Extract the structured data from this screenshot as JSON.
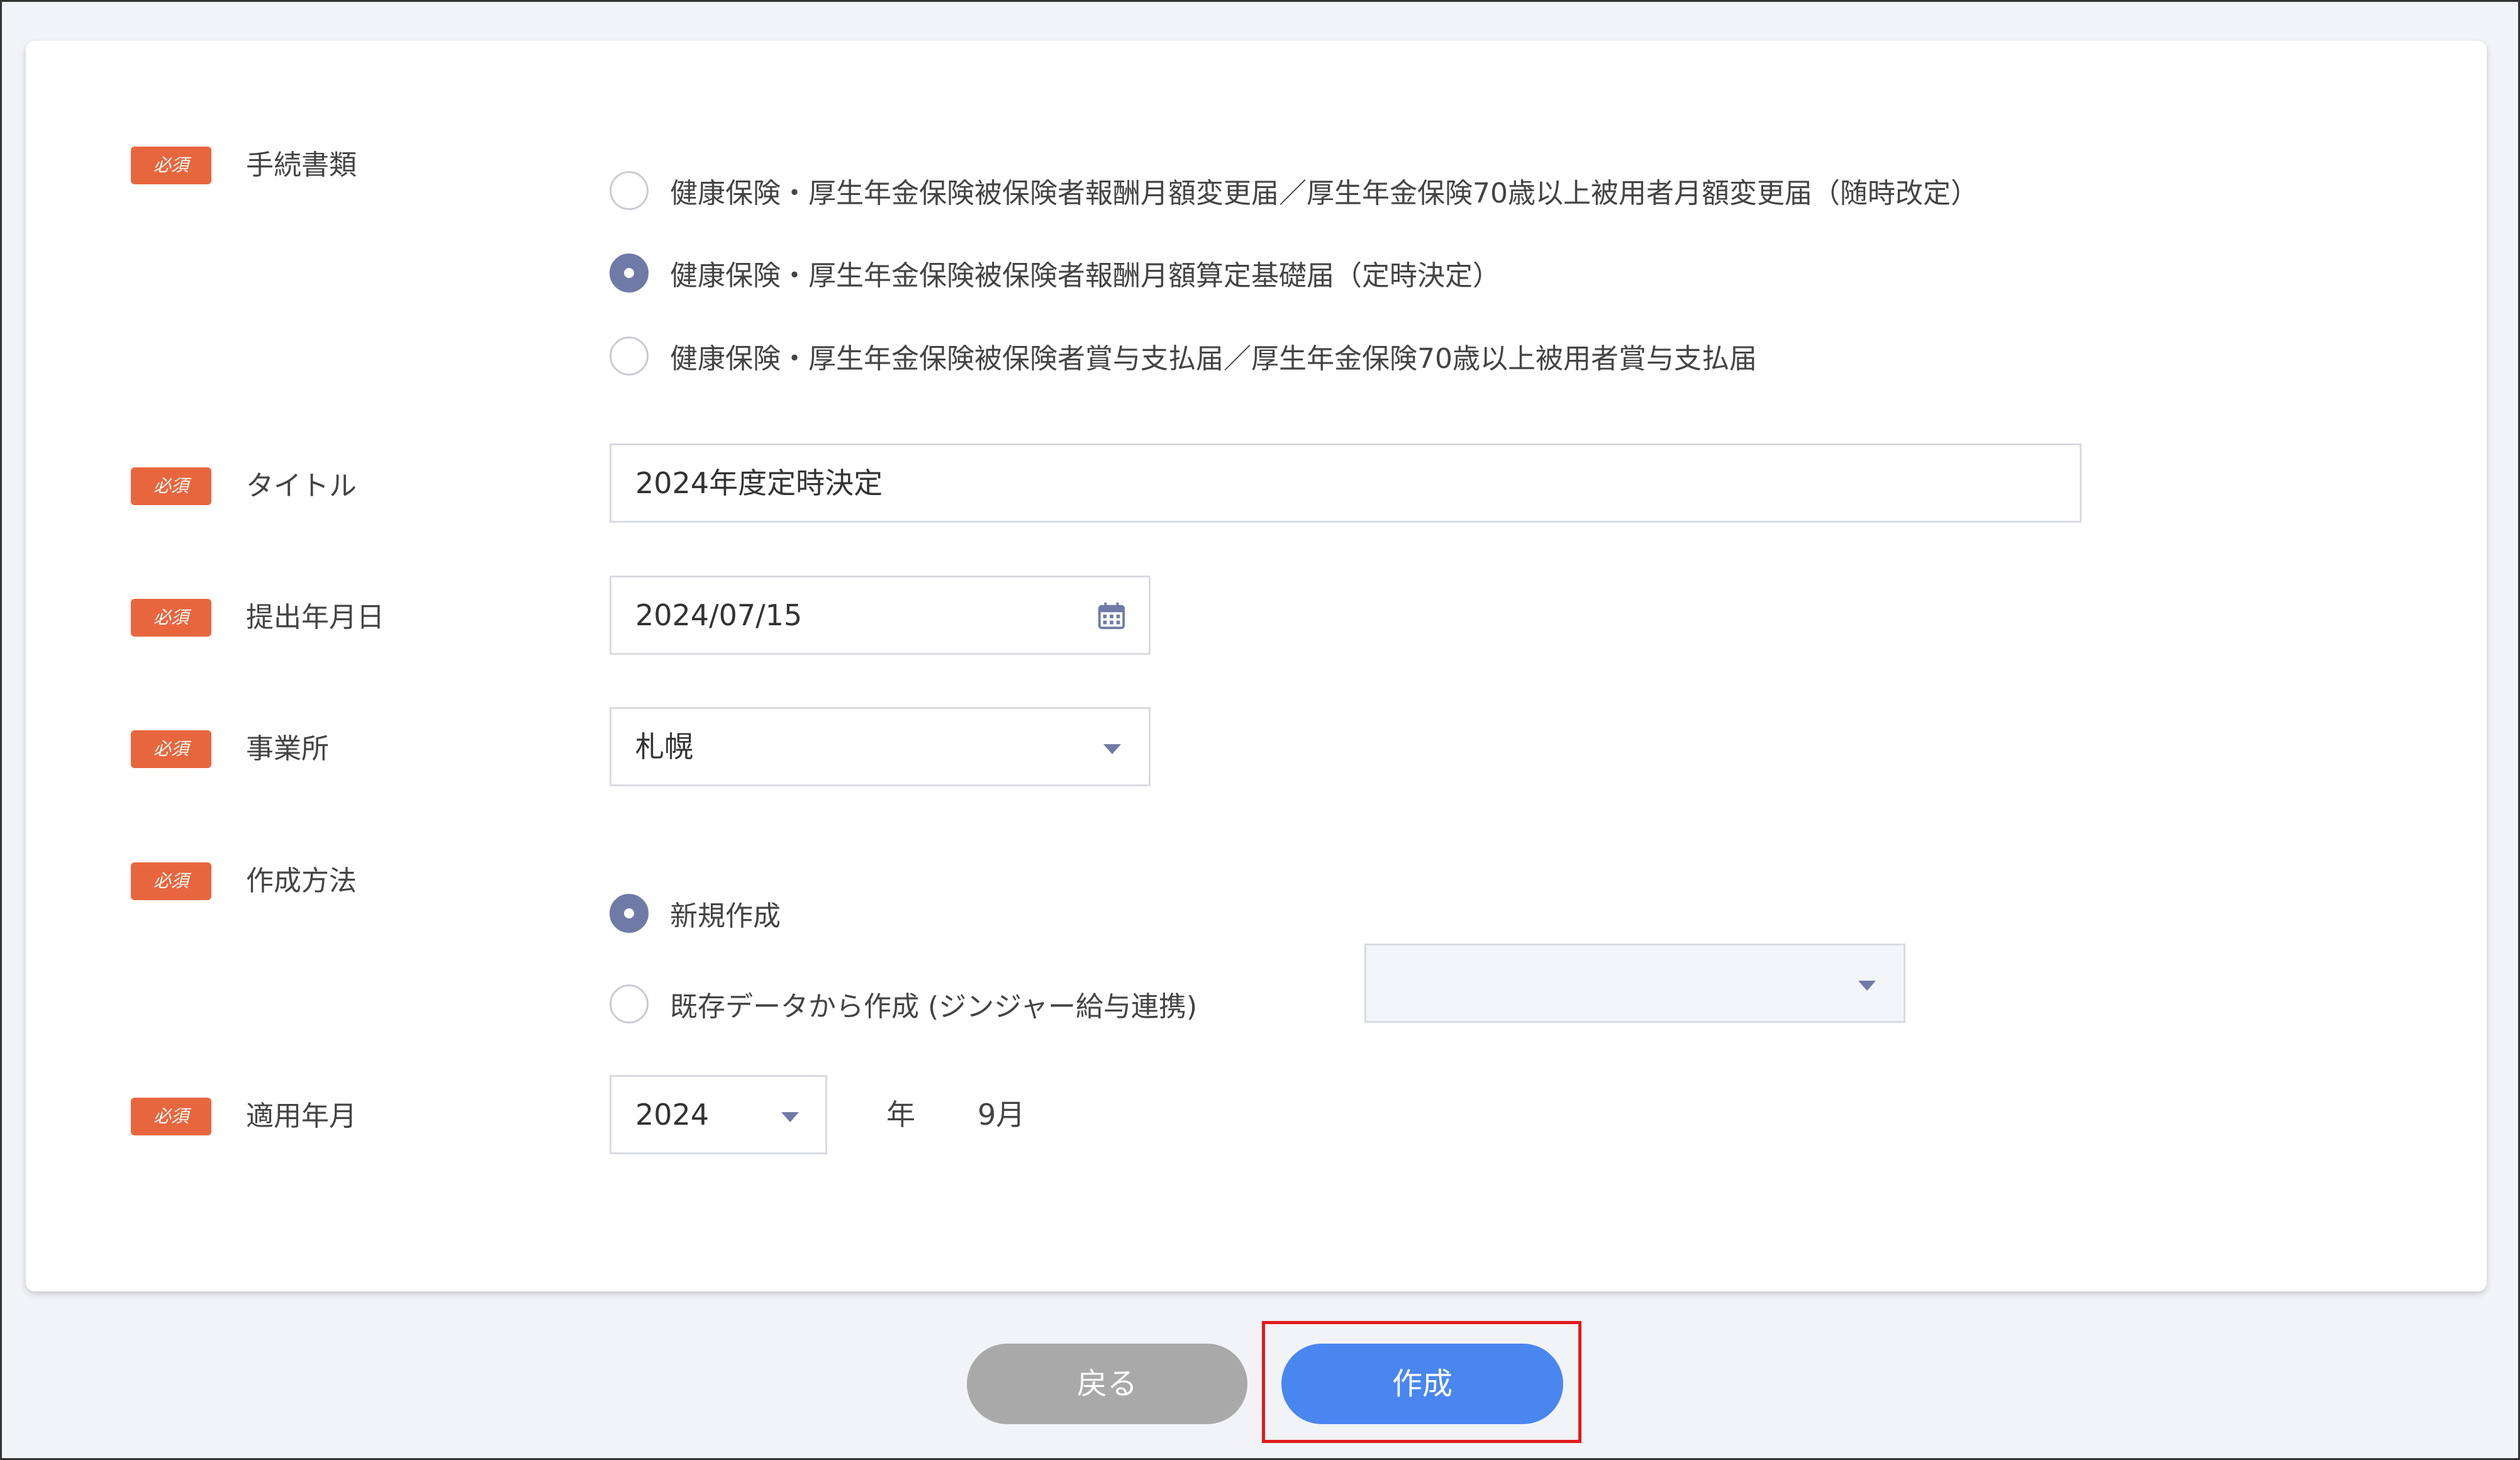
{
  "form": {
    "required_badge": "必須",
    "procedure": {
      "label": "手続書類",
      "options": [
        {
          "text": "健康保険・厚生年金保険被保険者報酬月額変更届／厚生年金保険70歳以上被用者月額変更届（随時改定）",
          "selected": false
        },
        {
          "text": "健康保険・厚生年金保険被保険者報酬月額算定基礎届（定時決定）",
          "selected": true
        },
        {
          "text": "健康保険・厚生年金保険被保険者賞与支払届／厚生年金保険70歳以上被用者賞与支払届",
          "selected": false
        }
      ]
    },
    "title": {
      "label": "タイトル",
      "value": "2024年度定時決定"
    },
    "submit_date": {
      "label": "提出年月日",
      "value": "2024/07/15",
      "icon": "calendar-icon"
    },
    "office": {
      "label": "事業所",
      "value": "札幌"
    },
    "creation_method": {
      "label": "作成方法",
      "options": [
        {
          "text": "新規作成",
          "selected": true
        },
        {
          "text": "既存データから作成 (ジンジャー給与連携)",
          "selected": false
        }
      ],
      "existing_data_select_value": ""
    },
    "apply_month": {
      "label": "適用年月",
      "year_value": "2024",
      "year_suffix": "年",
      "month_text": "9月"
    }
  },
  "buttons": {
    "back_label": "戻る",
    "create_label": "作成"
  },
  "colors": {
    "badge": "#e8663e",
    "radio_checked": "#6f7ba6",
    "primary_button": "#4a86f0",
    "secondary_button": "#a9a9a9",
    "highlight_border": "#e01b1b"
  }
}
